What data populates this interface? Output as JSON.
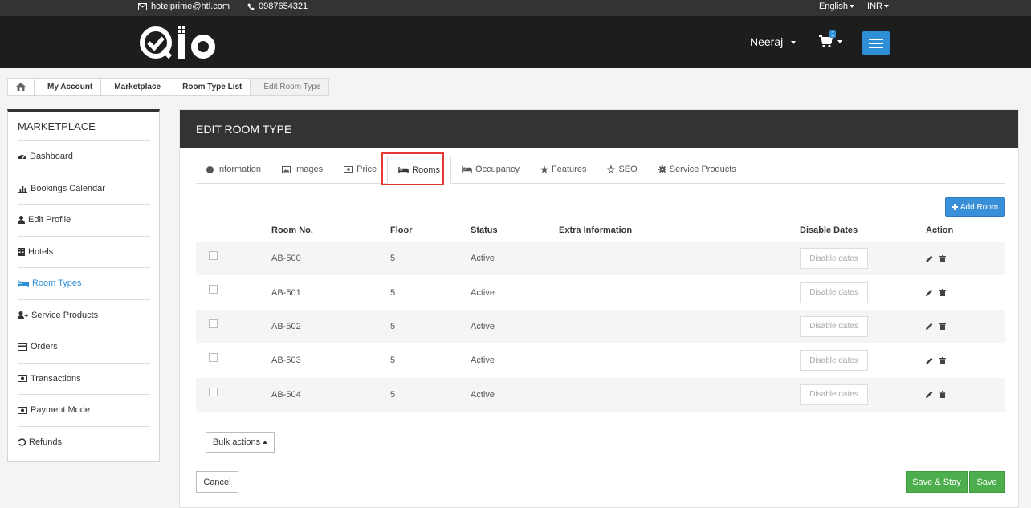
{
  "topbar": {
    "email": "hotelprime@htl.com",
    "phone": "0987654321",
    "language": "English",
    "currency": "INR"
  },
  "header": {
    "user_name": "Neeraj",
    "cart_count": "1"
  },
  "breadcrumb": {
    "items": [
      "My Account",
      "Marketplace",
      "Room Type List",
      "Edit Room Type"
    ]
  },
  "sidebar": {
    "title": "MARKETPLACE",
    "items": [
      {
        "label": "Dashboard",
        "icon": "dashboard-icon"
      },
      {
        "label": "Bookings Calendar",
        "icon": "bar-chart-icon"
      },
      {
        "label": "Edit Profile",
        "icon": "user-icon"
      },
      {
        "label": "Hotels",
        "icon": "building-icon"
      },
      {
        "label": "Room Types",
        "icon": "bed-icon"
      },
      {
        "label": "Service Products",
        "icon": "user-plus-icon"
      },
      {
        "label": "Orders",
        "icon": "credit-card-icon"
      },
      {
        "label": "Transactions",
        "icon": "money-icon"
      },
      {
        "label": "Payment Mode",
        "icon": "money-icon"
      },
      {
        "label": "Refunds",
        "icon": "undo-icon"
      }
    ]
  },
  "main": {
    "title": "EDIT ROOM TYPE",
    "tabs": [
      {
        "label": "Information",
        "icon": "info-icon"
      },
      {
        "label": "Images",
        "icon": "image-icon"
      },
      {
        "label": "Price",
        "icon": "money-icon"
      },
      {
        "label": "Rooms",
        "icon": "bed-icon"
      },
      {
        "label": "Occupancy",
        "icon": "bed-icon"
      },
      {
        "label": "Features",
        "icon": "star-icon"
      },
      {
        "label": "SEO",
        "icon": "star-outline-icon"
      },
      {
        "label": "Service Products",
        "icon": "gear-icon"
      }
    ],
    "add_room_label": "Add Room",
    "columns": [
      "Room No.",
      "Floor",
      "Status",
      "Extra Information",
      "Disable Dates",
      "Action"
    ],
    "rows": [
      {
        "room_no": "AB-500",
        "floor": "5",
        "status": "Active",
        "extra": "",
        "disable_label": "Disable dates"
      },
      {
        "room_no": "AB-501",
        "floor": "5",
        "status": "Active",
        "extra": "",
        "disable_label": "Disable dates"
      },
      {
        "room_no": "AB-502",
        "floor": "5",
        "status": "Active",
        "extra": "",
        "disable_label": "Disable dates"
      },
      {
        "room_no": "AB-503",
        "floor": "5",
        "status": "Active",
        "extra": "",
        "disable_label": "Disable dates"
      },
      {
        "room_no": "AB-504",
        "floor": "5",
        "status": "Active",
        "extra": "",
        "disable_label": "Disable dates"
      }
    ],
    "bulk_label": "Bulk actions",
    "cancel_label": "Cancel",
    "save_stay_label": "Save & Stay",
    "save_label": "Save"
  },
  "colors": {
    "accent": "#2d8fd5",
    "header_bg": "#1d1d1d",
    "success": "#4cae4c",
    "highlight": "#e53935"
  }
}
